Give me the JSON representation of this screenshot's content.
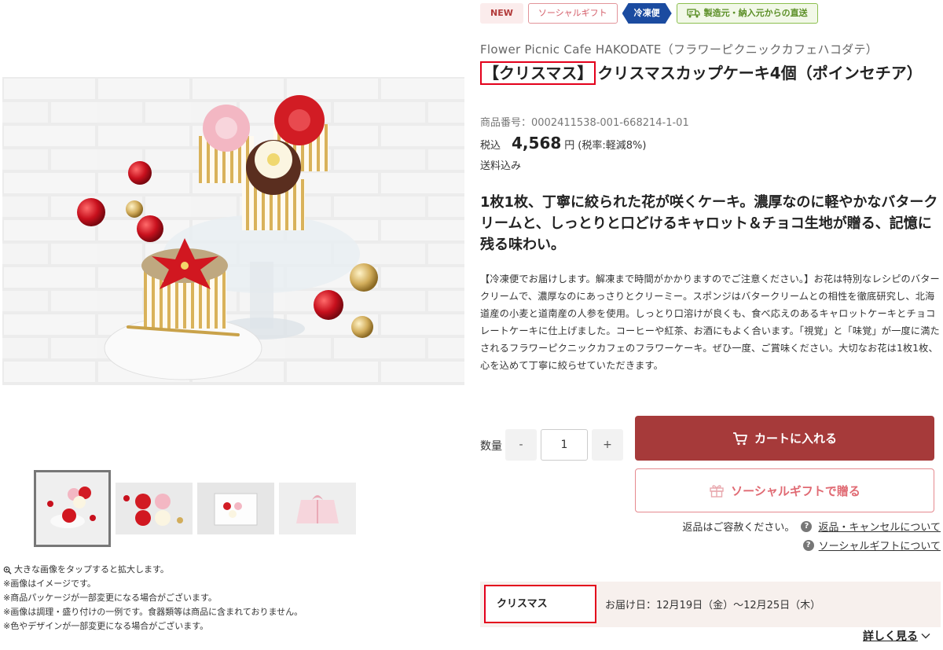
{
  "badges": {
    "new": "NEW",
    "social_gift": "ソーシャルギフト",
    "frozen": "冷凍便",
    "direct": "製造元・納入元からの直送"
  },
  "product": {
    "brand": "Flower Picnic Cafe HAKODATE（フラワーピクニックカフェハコダテ）",
    "title_highlight": "【クリスマス】",
    "title_rest": "クリスマスカップケーキ4個（ポインセチア）",
    "sku": "商品番号：0002411538-001-668214-1-01",
    "price_label": "税込",
    "price": "4,568",
    "price_unit": "円",
    "tax_note": "(税率:軽減8%)",
    "shipping": "送料込み",
    "catch": "1枚1枚、丁寧に絞られた花が咲くケーキ。濃厚なのに軽やかなバタークリームと、しっとりと口どけるキャロット＆チョコ生地が贈る、記憶に残る味わい。",
    "description": "【冷凍便でお届けします。解凍まで時間がかかりますのでご注意ください。】お花は特別なレシピのバタークリームで、濃厚なのにあっさりとクリーミー。スポンジはバタークリームとの相性を徹底研究し、北海道産の小麦と道南産の人参を使用。しっとり口溶けが良くも、食べ応えのあるキャロットケーキとチョコレートケーキに仕上げました。コーヒーや紅茶、お酒にもよく合います。「視覚」と「味覚」が一度に満たされるフラワーピクニックカフェのフラワーケーキ。ぜひ一度、ご賞味ください。大切なお花は1枚1枚、心を込めて丁寧に絞らせていただきます。"
  },
  "quantity": {
    "label": "数量",
    "minus": "-",
    "value": "1",
    "plus": "+"
  },
  "actions": {
    "cart": "カートに入れる",
    "gift": "ソーシャルギフトで贈る"
  },
  "policy": {
    "no_return": "返品はご容赦ください。",
    "return_link": "返品・キャンセルについて",
    "gift_link": "ソーシャルギフトについて",
    "help": "?"
  },
  "delivery": {
    "tag": "クリスマス",
    "date": "お届け日：12月19日（金）〜12月25日（木）",
    "more": "詳しく見る"
  },
  "notes": [
    "大きな画像をタップすると拡大します。",
    "※画像はイメージです。",
    "※商品パッケージが一部変更になる場合がございます。",
    "※画像は調理・盛り付けの一例です。食器類等は商品に含まれておりません。",
    "※色やデザインが一部変更になる場合がございます。"
  ],
  "colors": {
    "cart_button": "#a63a3a",
    "gift_accent": "#e06a73",
    "frozen_badge": "#1b4ba0",
    "direct_badge": "#5c8f27",
    "highlight_border": "#e3001b"
  }
}
